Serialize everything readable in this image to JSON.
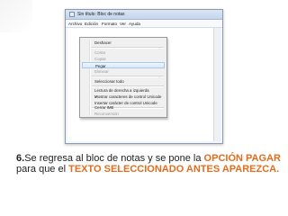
{
  "colors": {
    "accent": "#e36c1d",
    "caption_text": "#222222"
  },
  "window": {
    "title": "Sin título: Bloc de notas",
    "menu": [
      "Archivo",
      "Edición",
      "Formato",
      "Ver",
      "Ayuda"
    ]
  },
  "context_menu": {
    "items": [
      {
        "label": "Deshacer",
        "disabled": false,
        "checked": false,
        "highlighted": false
      },
      {
        "label": "Cortar",
        "disabled": true,
        "checked": false,
        "highlighted": false
      },
      {
        "label": "Copiar",
        "disabled": true,
        "checked": false,
        "highlighted": false
      },
      {
        "label": "Pegar",
        "disabled": false,
        "checked": false,
        "highlighted": true
      },
      {
        "label": "Eliminar",
        "disabled": true,
        "checked": false,
        "highlighted": false
      },
      {
        "label": "Seleccionar todo",
        "disabled": false,
        "checked": false,
        "highlighted": false
      },
      {
        "label": "Lectura de derecha a izquierda",
        "disabled": false,
        "checked": false,
        "highlighted": false
      },
      {
        "label": "Mostrar caracteres de control Unicode",
        "disabled": false,
        "checked": true,
        "highlighted": false
      },
      {
        "label": "Insertar carácter de control Unicode",
        "disabled": false,
        "checked": false,
        "highlighted": false
      },
      {
        "label": "Cerrar IME",
        "disabled": false,
        "checked": false,
        "highlighted": false
      },
      {
        "label": "Reconversión",
        "disabled": true,
        "checked": false,
        "highlighted": false
      }
    ],
    "check_glyph": "✓"
  },
  "caption": {
    "step": "6.",
    "text1": "Se regresa al bloc de notas y se pone la ",
    "accent1": "OPCIÓN PAGAR",
    "text2": " para que el ",
    "accent2": "TEXTO SELECCIONADO ANTES APAREZCA."
  }
}
